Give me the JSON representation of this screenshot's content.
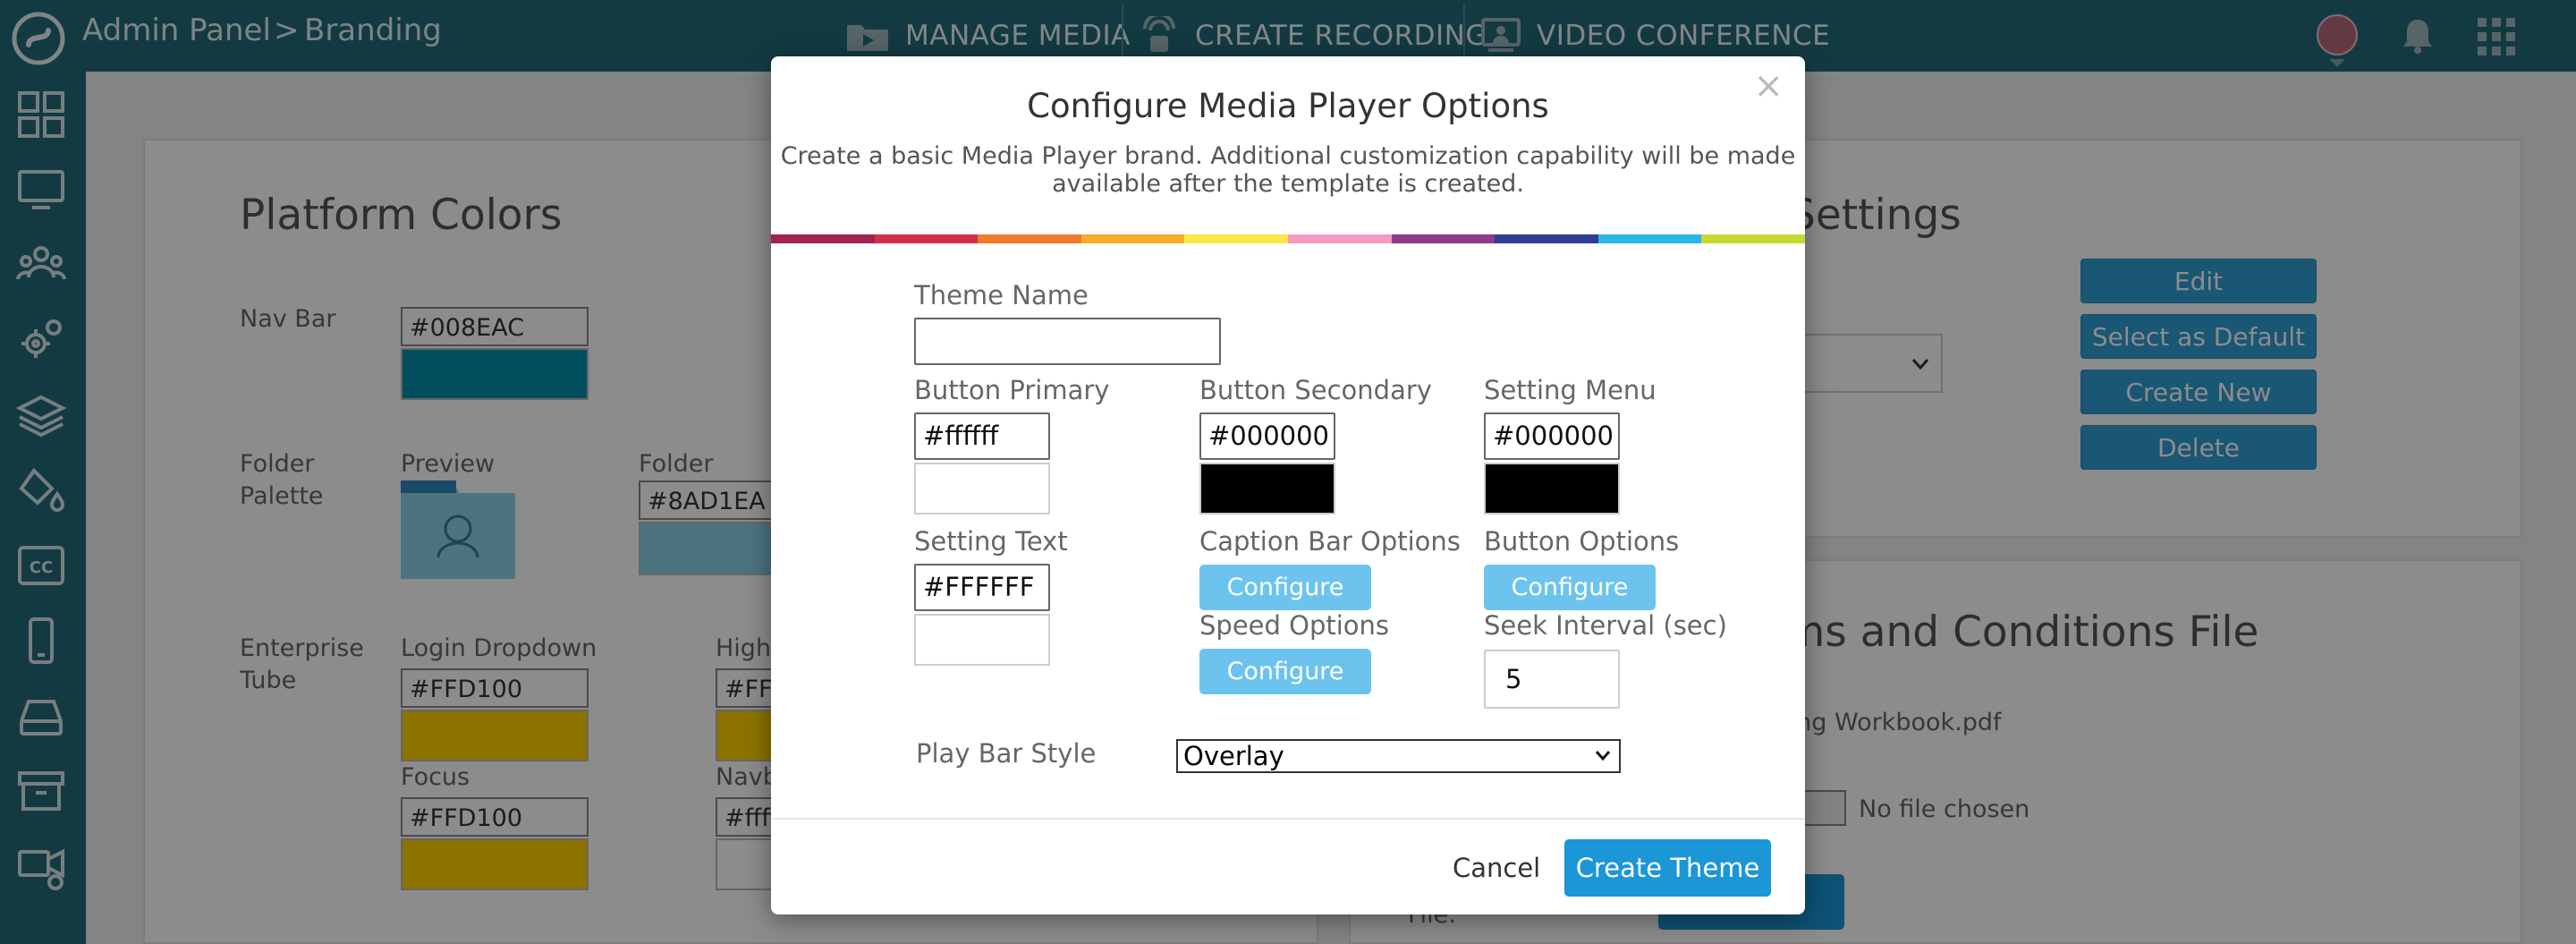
{
  "topbar": {
    "breadcrumb_root": "Admin Panel",
    "breadcrumb_sep": ">",
    "breadcrumb_current": "Branding",
    "nav": [
      {
        "label": "MANAGE MEDIA",
        "icon": "media-folder-icon"
      },
      {
        "label": "CREATE RECORDING",
        "icon": "recording-icon"
      },
      {
        "label": "VIDEO CONFERENCE",
        "icon": "video-conference-icon"
      }
    ],
    "right_icons": [
      "user-avatar",
      "bell-icon",
      "apps-grid-icon"
    ]
  },
  "sidebar": {
    "icons": [
      "dashboard-icon",
      "monitor-icon",
      "users-icon",
      "settings-icon",
      "layers-icon",
      "paint-bucket-icon",
      "closed-caption-icon",
      "mobile-icon",
      "drive-icon",
      "archive-icon",
      "video-camera-icon"
    ]
  },
  "background": {
    "platform_colors": {
      "heading": "Platform Colors",
      "nav_bar_label": "Nav Bar",
      "nav_bar_value": "#008EAC",
      "folder_palette_label": "Folder\nPalette",
      "preview_label": "Preview",
      "folder_label": "Folder",
      "folder_value": "#8AD1EA",
      "enterprise_tube_label": "Enterprise\nTube",
      "login_dropdown_label": "Login Dropdown",
      "login_dropdown_value": "#FFD100",
      "highlight_label": "Highl",
      "highlight_value": "#FFD",
      "focus_label": "Focus",
      "focus_value": "#FFD100",
      "navbar_label": "Navb",
      "navbar_value": "#ffff"
    },
    "settings": {
      "heading": "Settings",
      "buttons": [
        "Edit",
        "Select as Default",
        "Create New",
        "Delete"
      ]
    },
    "terms": {
      "heading": "rms and Conditions File",
      "file_name": "ining Workbook.pdf",
      "choose_button": "le",
      "no_file": "No file chosen",
      "file_label": "File:"
    }
  },
  "modal": {
    "title": "Configure Media Player Options",
    "subtitle_line1": "Create a basic Media Player brand. Additional customization capability will be made",
    "subtitle_line2": "available after the template is created.",
    "close": "×",
    "stripe_colors": [
      "#a3224f",
      "#d42f4a",
      "#f07a2a",
      "#f6ac2c",
      "#fce84a",
      "#f49ac1",
      "#8e3a8e",
      "#2f3d94",
      "#28b7e8",
      "#c5d931"
    ],
    "fields": {
      "theme_name": {
        "label": "Theme Name",
        "value": ""
      },
      "button_primary": {
        "label": "Button Primary",
        "value": "#ffffff",
        "swatch": "#ffffff"
      },
      "button_secondary": {
        "label": "Button Secondary",
        "value": "#000000",
        "swatch": "#000000"
      },
      "setting_menu": {
        "label": "Setting Menu",
        "value": "#000000",
        "swatch": "#000000"
      },
      "setting_text": {
        "label": "Setting Text",
        "value": "#FFFFFF",
        "swatch": "#ffffff"
      },
      "caption_bar_options": {
        "label": "Caption Bar Options",
        "button": "Configure"
      },
      "button_options": {
        "label": "Button Options",
        "button": "Configure"
      },
      "speed_options": {
        "label": "Speed Options",
        "button": "Configure"
      },
      "seek_interval": {
        "label": "Seek Interval (sec)",
        "value": "5"
      },
      "play_bar_style": {
        "label": "Play Bar Style",
        "selected": "Overlay"
      }
    },
    "cancel": "Cancel",
    "submit": "Create Theme"
  }
}
